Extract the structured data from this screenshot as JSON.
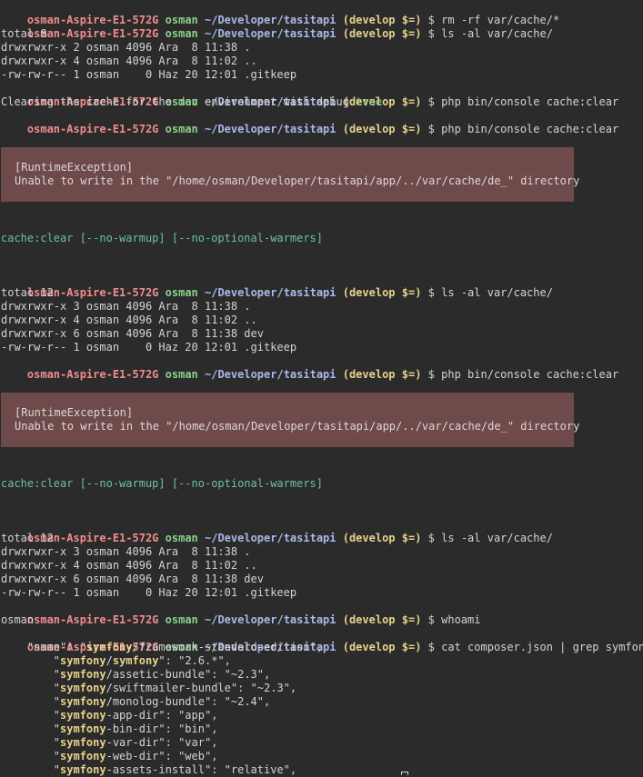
{
  "prompt": {
    "host": "osman-Aspire-E1-572G",
    "user": "osman",
    "path": "~/Developer/tasitapi",
    "branch": "(develop $=)",
    "symbol": "$"
  },
  "commands": {
    "rm": "rm -rf var/cache/*",
    "ls": "ls -al var/cache/",
    "clear": "php bin/console cache:clear",
    "whoami": "whoami",
    "cat": "cat composer.json | grep symfony"
  },
  "listing1": {
    "total": "total 8",
    "rows": [
      "drwxrwxr-x 2 osman 4096 Ara  8 11:38 .",
      "drwxrwxr-x 4 osman 4096 Ara  8 11:02 ..",
      "-rw-rw-r-- 1 osman    0 Haz 20 12:01 .gitkeep"
    ]
  },
  "clearing": {
    "prefix": "Clearing the cache for the ",
    "env": "dev",
    "middle": " environment with debug ",
    "debug": "true"
  },
  "error": {
    "title": "[RuntimeException]",
    "message": "Unable to write in the \"/home/osman/Developer/tasitapi/app/../var/cache/de_\" directory"
  },
  "usage": "cache:clear [--no-warmup] [--no-optional-warmers]",
  "listing2": {
    "total": "total 12",
    "rows": [
      "drwxrwxr-x 3 osman 4096 Ara  8 11:38 .",
      "drwxrwxr-x 4 osman 4096 Ara  8 11:02 ..",
      "drwxrwxr-x 6 osman 4096 Ara  8 11:38 dev",
      "-rw-rw-r-- 1 osman    0 Haz 20 12:01 .gitkeep"
    ]
  },
  "whoami_output": "osman",
  "grep": {
    "keyword": "symfony",
    "name_line": {
      "pre": "    \"name\": \"",
      "kw": "symfony",
      "post": "/framework-standard-edition\","
    },
    "lines": [
      {
        "pre": "        \"",
        "kw": "symfony",
        "mid": "/",
        "kw2": "symfony",
        "post": "\": \"2.6.*\","
      },
      {
        "pre": "        \"",
        "kw": "symfony",
        "post": "/assetic-bundle\": \"~2.3\","
      },
      {
        "pre": "        \"",
        "kw": "symfony",
        "post": "/swiftmailer-bundle\": \"~2.3\","
      },
      {
        "pre": "        \"",
        "kw": "symfony",
        "post": "/monolog-bundle\": \"~2.4\","
      },
      {
        "pre": "        \"",
        "kw": "symfony",
        "post": "-app-dir\": \"app\","
      },
      {
        "pre": "        \"",
        "kw": "symfony",
        "post": "-bin-dir\": \"bin\","
      },
      {
        "pre": "        \"",
        "kw": "symfony",
        "post": "-var-dir\": \"var\","
      },
      {
        "pre": "        \"",
        "kw": "symfony",
        "post": "-web-dir\": \"web\","
      },
      {
        "pre": "        \"",
        "kw": "symfony",
        "post": "-assets-install\": \"relative\","
      }
    ]
  }
}
